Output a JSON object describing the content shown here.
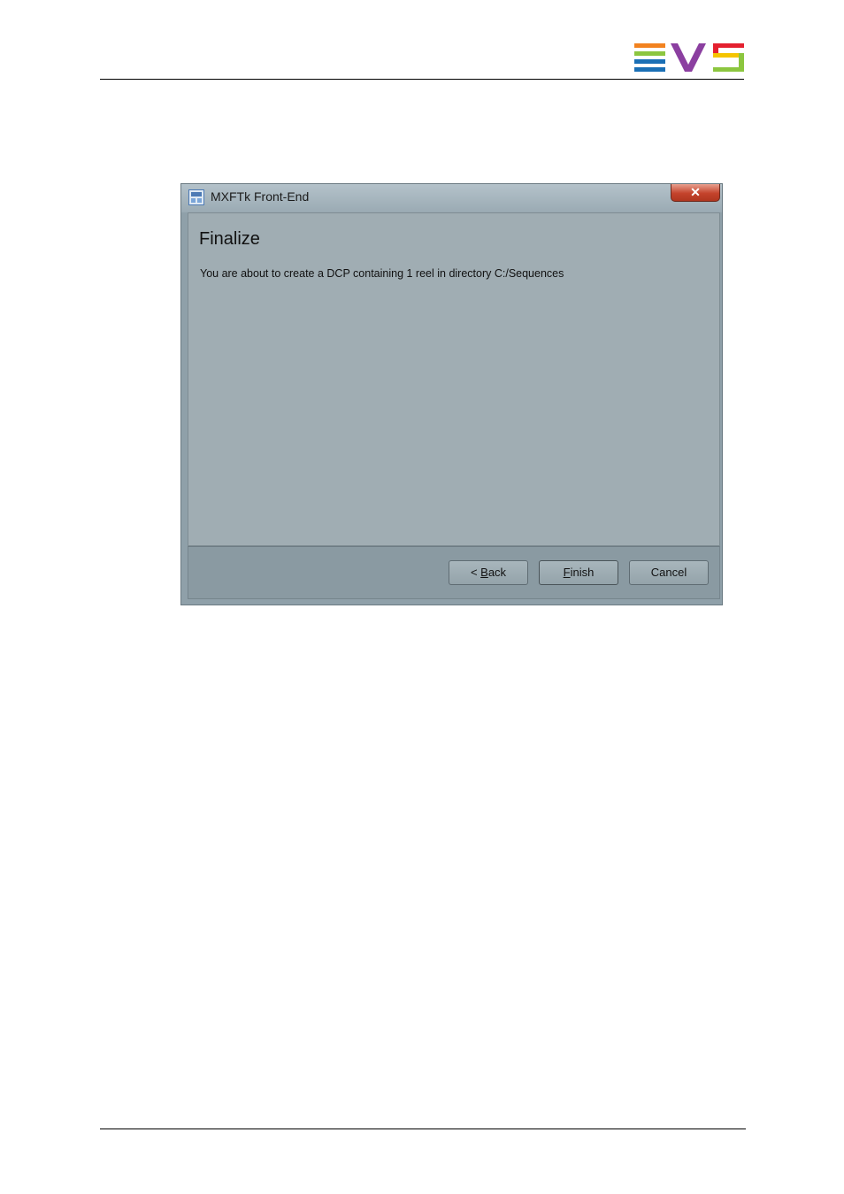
{
  "window": {
    "title": "MXFTk Front-End",
    "close_glyph": "✕"
  },
  "wizard": {
    "heading": "Finalize",
    "message": "You are about to create a DCP containing  1 reel in directory C:/Sequences"
  },
  "buttons": {
    "back": {
      "prefix": "< ",
      "mnemonic": "B",
      "rest": "ack"
    },
    "finish": {
      "prefix": "",
      "mnemonic": "F",
      "rest": "inish"
    },
    "cancel": {
      "label": "Cancel"
    }
  },
  "logo": {
    "name": "EVS",
    "colors": {
      "orange": "#f2821f",
      "green": "#8cc63f",
      "blue": "#1a6fb5",
      "purple": "#8b3fa0",
      "red": "#e4202f",
      "yellow": "#f5c400"
    }
  }
}
